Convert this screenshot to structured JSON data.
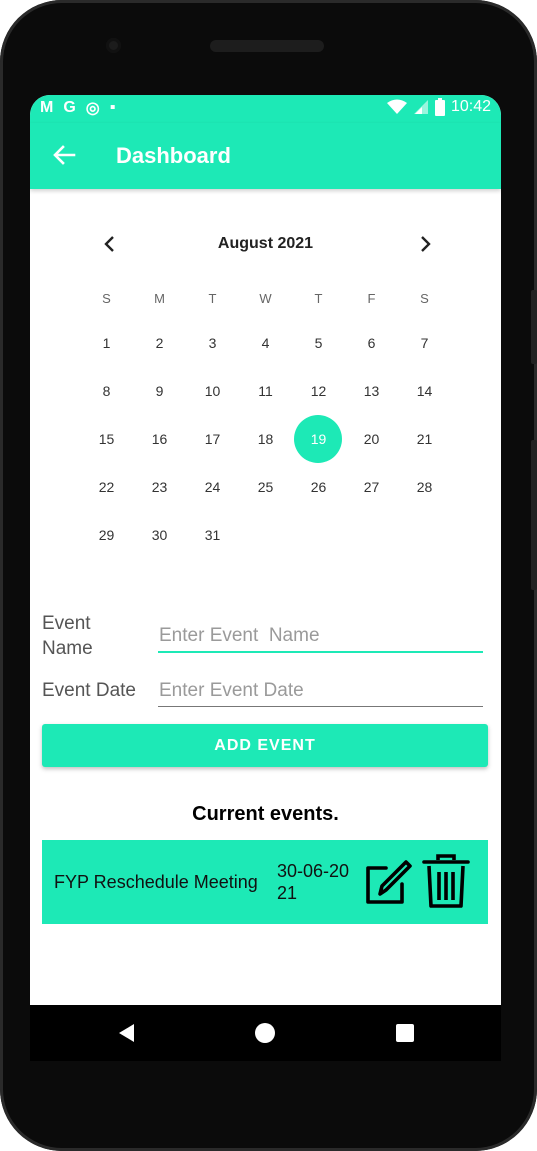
{
  "status_bar": {
    "left_icons": [
      "gmail-icon",
      "google-icon",
      "sync-icon",
      "sd-card-icon"
    ],
    "left_glyphs": [
      "M",
      "G",
      "◎",
      "▪"
    ],
    "right_icons": [
      "wifi-icon",
      "cell-signal-icon",
      "battery-icon"
    ],
    "time": "10:42"
  },
  "app_bar": {
    "title": "Dashboard",
    "back_icon": "arrow-back-icon"
  },
  "calendar": {
    "month_label": "August 2021",
    "days_of_week": [
      "S",
      "M",
      "T",
      "W",
      "T",
      "F",
      "S"
    ],
    "weeks": [
      [
        "1",
        "2",
        "3",
        "4",
        "5",
        "6",
        "7"
      ],
      [
        "8",
        "9",
        "10",
        "11",
        "12",
        "13",
        "14"
      ],
      [
        "15",
        "16",
        "17",
        "18",
        "19",
        "20",
        "21"
      ],
      [
        "22",
        "23",
        "24",
        "25",
        "26",
        "27",
        "28"
      ],
      [
        "29",
        "30",
        "31",
        "",
        "",
        "",
        ""
      ]
    ],
    "selected_day": "19"
  },
  "form": {
    "event_name_label": "Event\nName",
    "event_name_label_line1": "Event",
    "event_name_label_line2": "Name",
    "event_name_placeholder": "Enter Event  Name",
    "event_date_label": "Event Date",
    "event_date_placeholder": "Enter Event Date",
    "add_button": "ADD EVENT"
  },
  "events": {
    "title": "Current events.",
    "items": [
      {
        "name": "FYP Reschedule Meeting",
        "date": "30-06-2021"
      }
    ]
  },
  "colors": {
    "accent": "#1de9b6",
    "text": "#111111"
  }
}
